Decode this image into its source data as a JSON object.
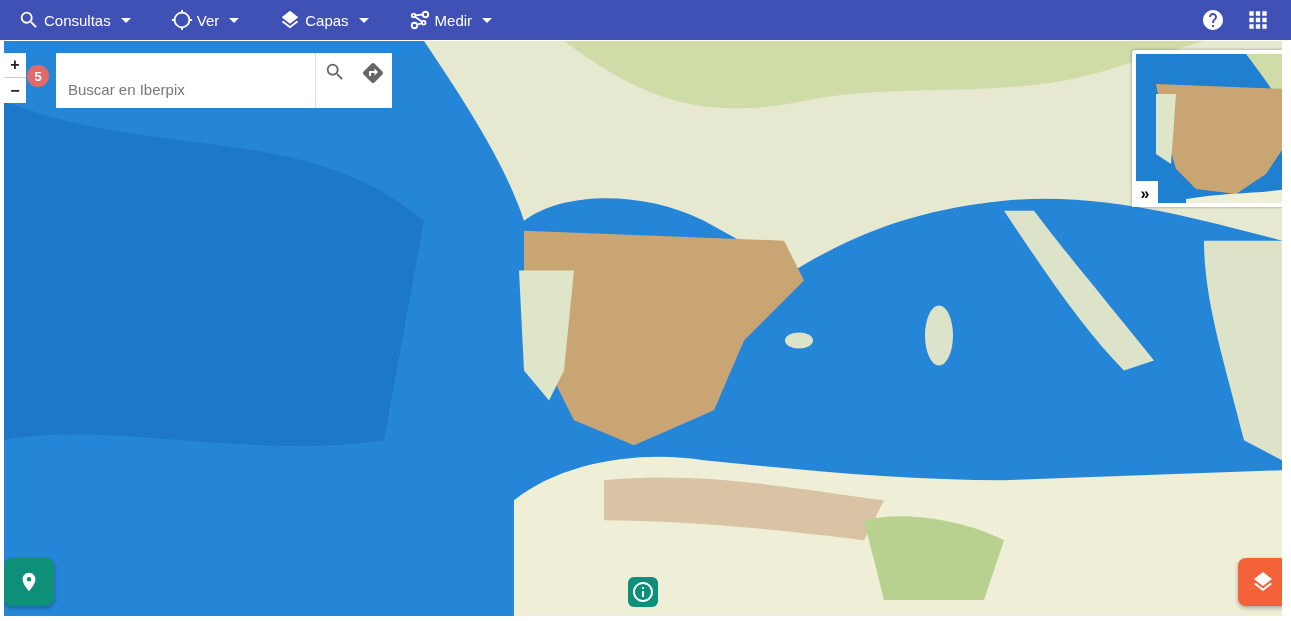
{
  "toolbar": {
    "menus": [
      {
        "label": "Consultas"
      },
      {
        "label": "Ver"
      },
      {
        "label": "Capas"
      },
      {
        "label": "Medir"
      }
    ]
  },
  "map": {
    "kind": "picture",
    "zoom": {
      "in": "+",
      "out": "−",
      "badge": "5"
    },
    "search": {
      "placeholder": "Buscar en Iberpix"
    },
    "overview": {
      "kind": "picture",
      "toggle": "»"
    }
  }
}
